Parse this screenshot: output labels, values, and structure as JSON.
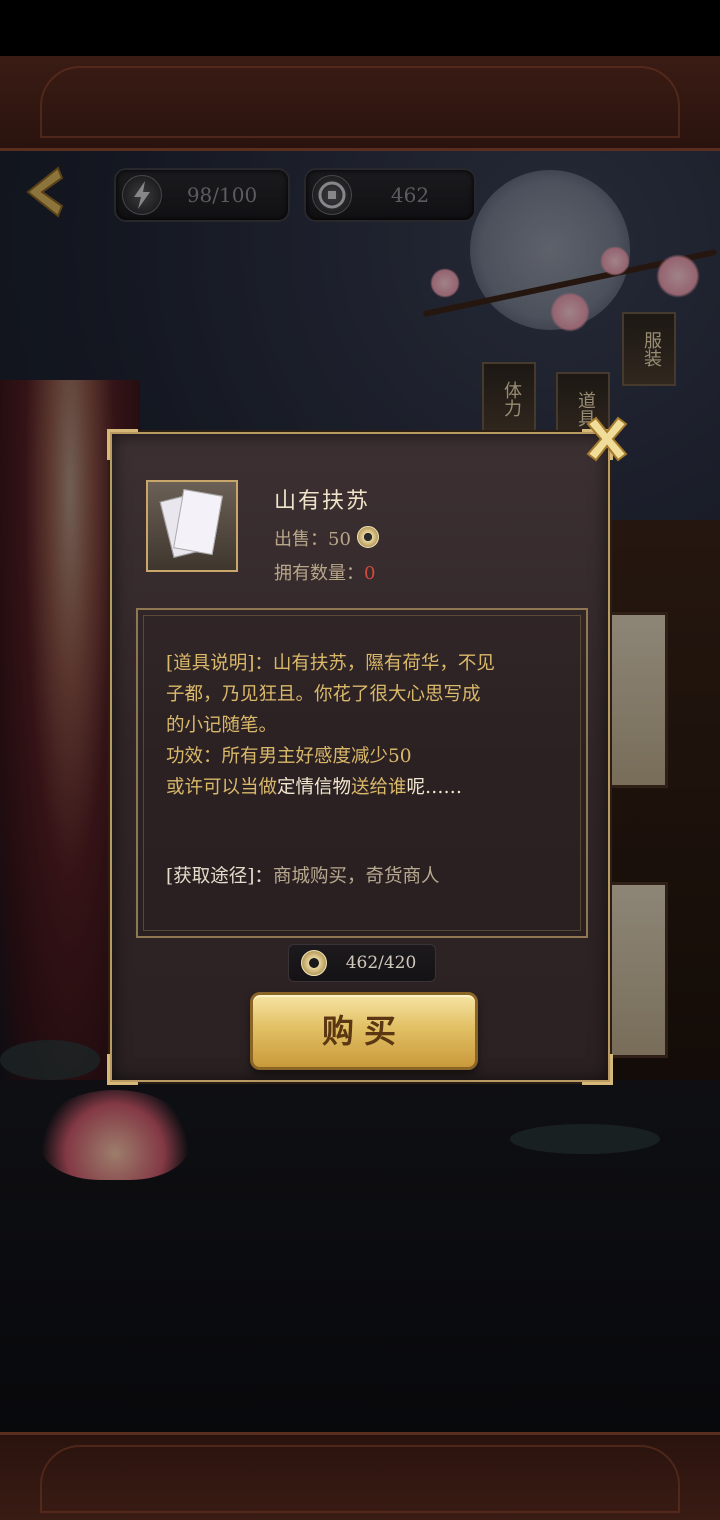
{
  "hud": {
    "back_icon": "chevron-left-icon",
    "stamina": {
      "icon": "lightning-icon",
      "value": "98/100"
    },
    "coins": {
      "icon": "coin-icon",
      "value": "462"
    }
  },
  "background": {
    "lanterns": [
      "体力",
      "道具",
      "服装"
    ]
  },
  "dialog": {
    "close_icon": "close-x-icon",
    "item": {
      "name": "山有扶苏",
      "price_label": "出售：",
      "price_value": "50",
      "owned_label": "拥有数量：",
      "owned_value": "0"
    },
    "description": {
      "line1": "[道具说明]：山有扶苏，隰有荷华，不见",
      "line2": "子都，乃见狂且。你花了很大心思写成",
      "line3": "的小记随笔。",
      "line4": "功效：所有男主好感度减少50",
      "line5_a": "或许可以当做",
      "line5_b": "定情信物",
      "line5_c": "送给谁",
      "line5_d": "呢……",
      "source_label": "[获取途径]：",
      "source_value": "商城购买，奇货商人"
    },
    "balance": "462/420",
    "buy_label": "购买"
  },
  "colors": {
    "gold_text": "#d9b86a",
    "owned_count": "#d24b3a",
    "dialog_border": "#b99a63",
    "button_gold": "#e2c064"
  }
}
